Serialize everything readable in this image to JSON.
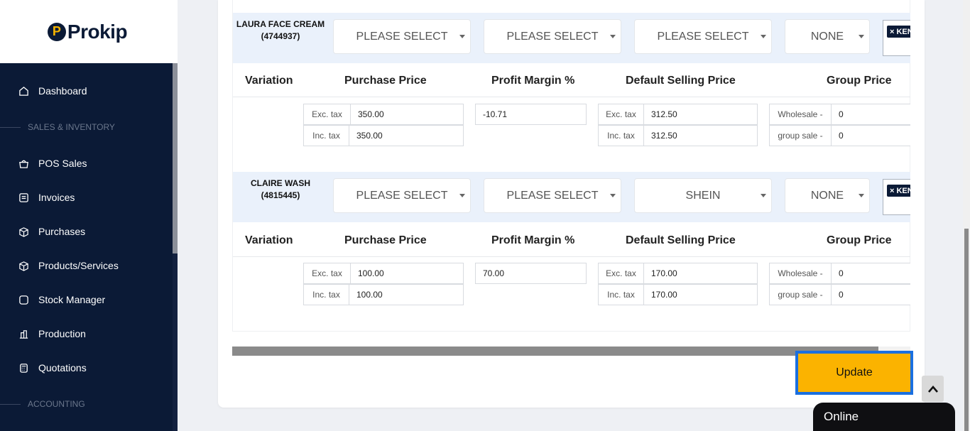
{
  "brand": {
    "logo_mark": "P",
    "name": "Prokip"
  },
  "sidebar": {
    "items": [
      {
        "label": "Dashboard",
        "icon": "home-icon"
      },
      {
        "label": "POS Sales",
        "icon": "basket-icon"
      },
      {
        "label": "Invoices",
        "icon": "invoice-icon"
      },
      {
        "label": "Purchases",
        "icon": "box-icon"
      },
      {
        "label": "Products/Services",
        "icon": "cube-icon"
      },
      {
        "label": "Stock Manager",
        "icon": "stock-icon"
      },
      {
        "label": "Production",
        "icon": "building-icon"
      },
      {
        "label": "Quotations",
        "icon": "calculator-icon"
      }
    ],
    "sections": [
      "SALES & INVENTORY",
      "ACCOUNTING"
    ]
  },
  "table_headers": [
    "Variation",
    "Purchase Price",
    "Profit Margin %",
    "Default Selling Price",
    "Group Price"
  ],
  "products": [
    {
      "name": "LAURA FACE CREAM",
      "sku": "(4744937)",
      "selects": [
        "PLEASE SELECT",
        "PLEASE SELECT",
        "PLEASE SELECT",
        "NONE"
      ],
      "tag": "× KEN",
      "exc_tax_label": "Exc. tax",
      "inc_tax_label": "Inc. tax",
      "purchase_exc": "350.00",
      "purchase_inc": "350.00",
      "margin": "-10.71",
      "selling_exc": "312.50",
      "selling_inc": "312.50",
      "group1_label": "Wholesale -",
      "group1_value": "0",
      "group2_label": "group sale -",
      "group2_value": "0"
    },
    {
      "name": "CLAIRE WASH",
      "sku": "(4815445)",
      "selects": [
        "PLEASE SELECT",
        "PLEASE SELECT",
        "SHEIN",
        "NONE"
      ],
      "tag": "× KEN",
      "exc_tax_label": "Exc. tax",
      "inc_tax_label": "Inc. tax",
      "purchase_exc": "100.00",
      "purchase_inc": "100.00",
      "margin": "70.00",
      "selling_exc": "170.00",
      "selling_inc": "170.00",
      "group1_label": "Wholesale -",
      "group1_value": "0",
      "group2_label": "group sale -",
      "group2_value": "0"
    }
  ],
  "update_label": "Update",
  "chat_status": "Online",
  "colors": {
    "sidebar_bg": "#0b1a36",
    "accent": "#fbb300",
    "focus": "#1a6fe0"
  }
}
